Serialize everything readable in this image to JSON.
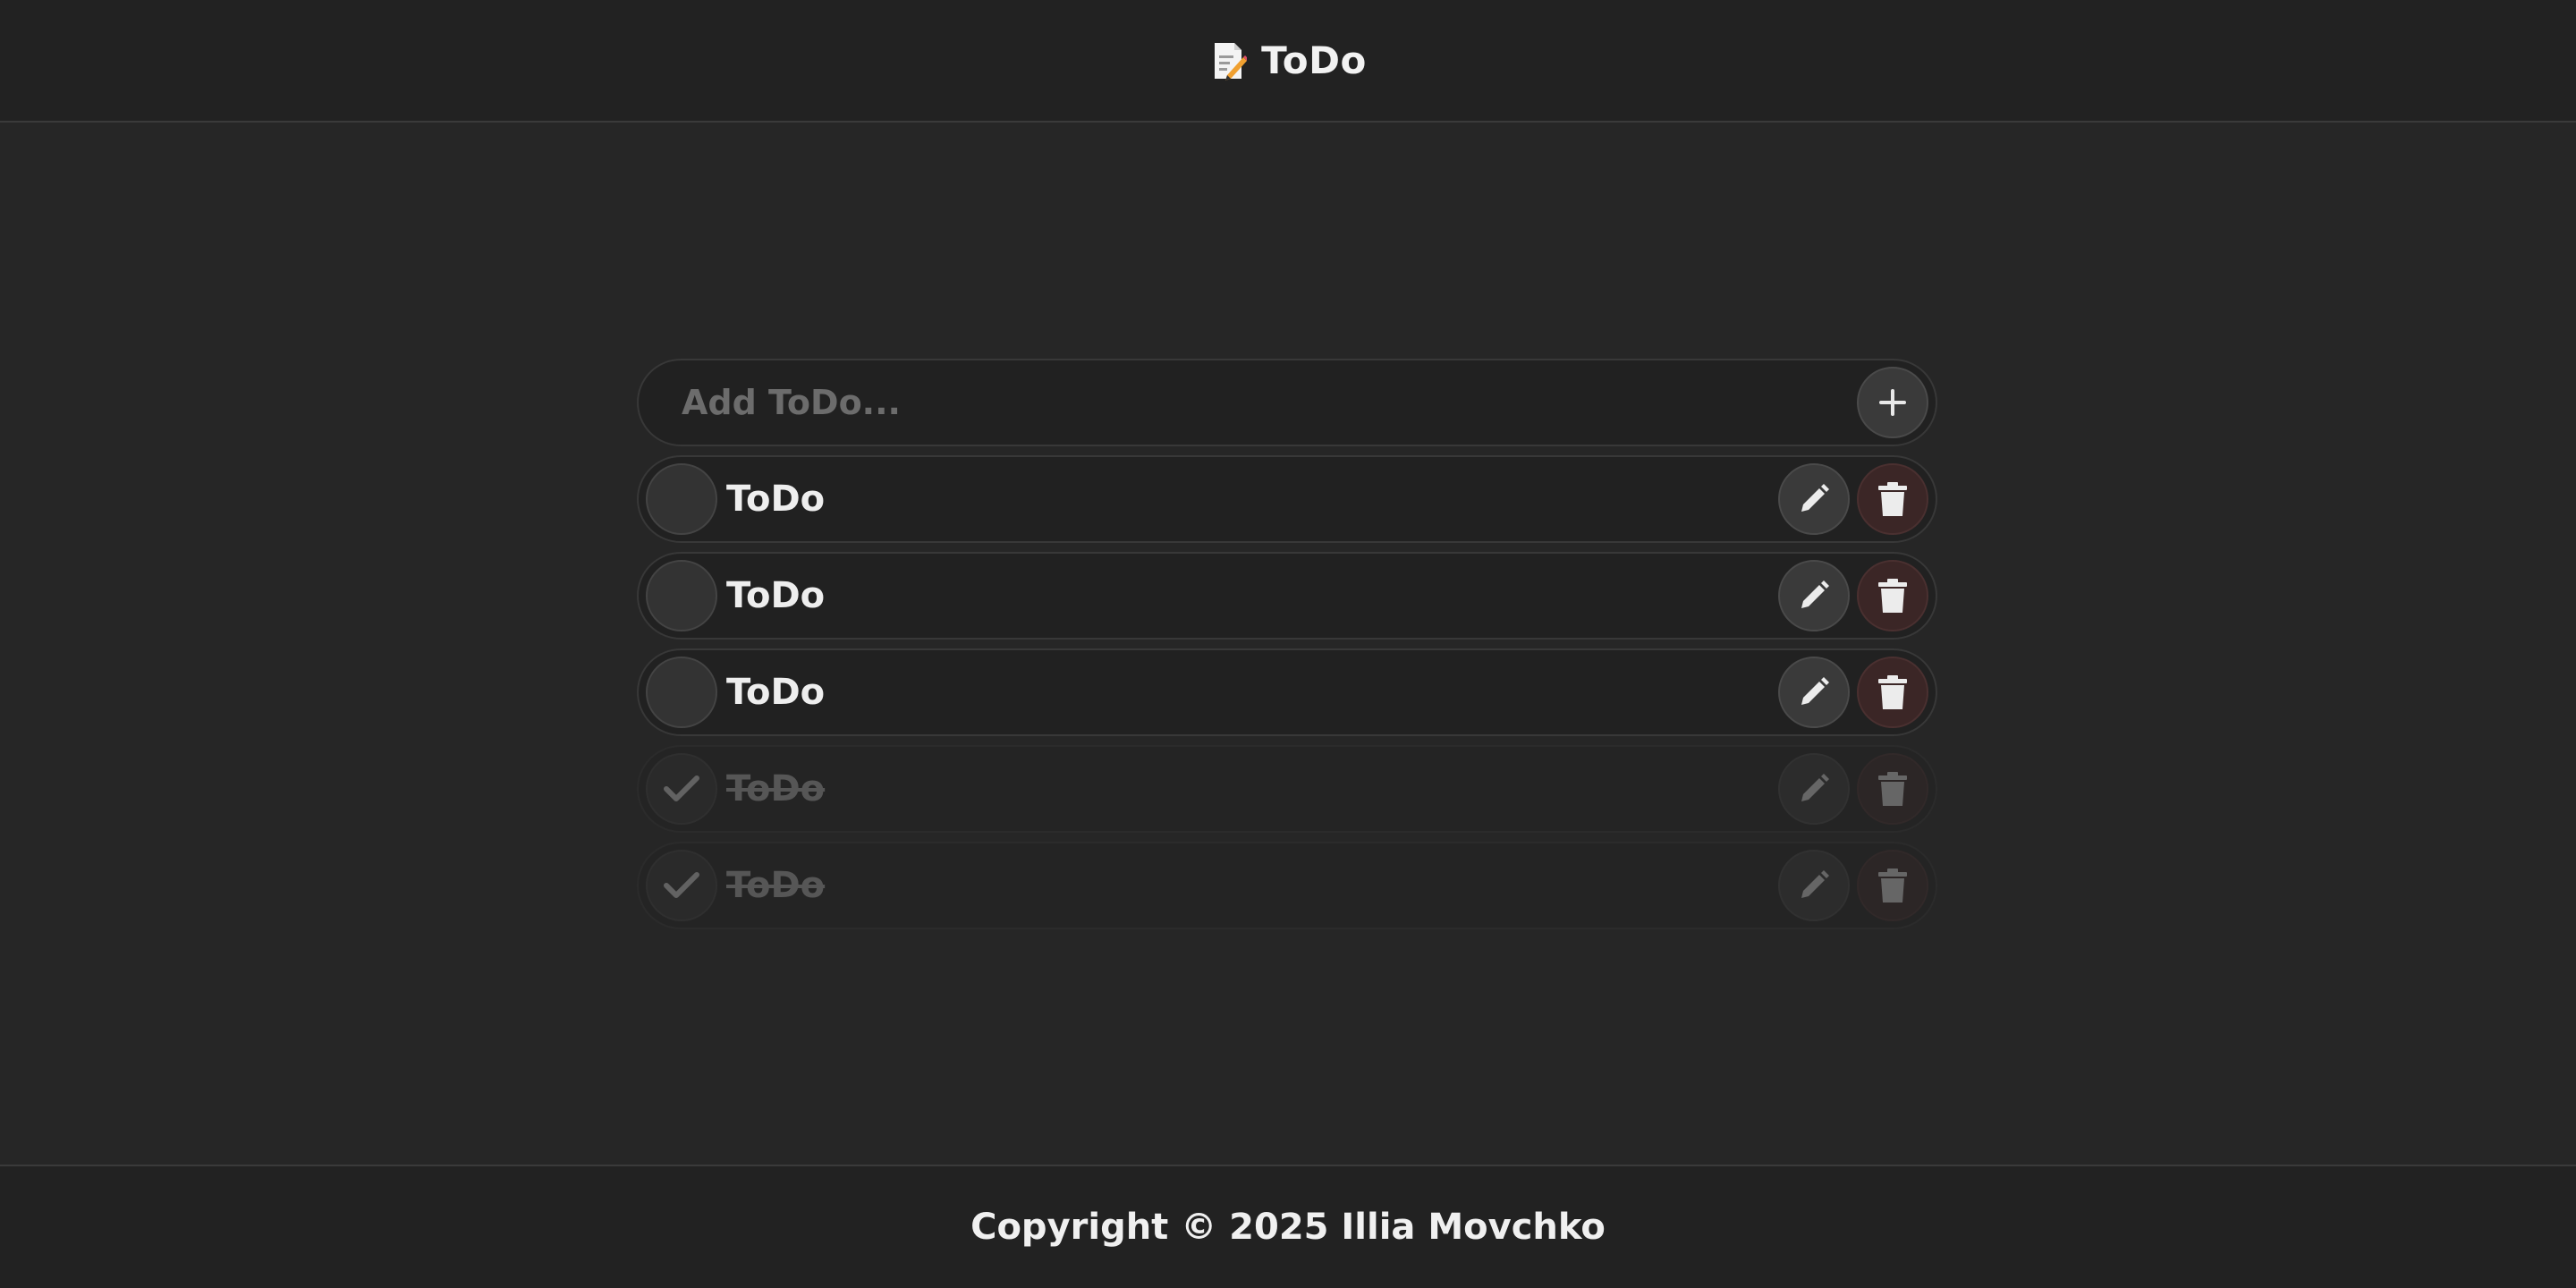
{
  "header": {
    "title": "ToDo",
    "icon": "memo-icon"
  },
  "add": {
    "placeholder": "Add ToDo...",
    "value": "",
    "button_icon": "plus-icon"
  },
  "todos": [
    {
      "text": "ToDo",
      "done": false
    },
    {
      "text": "ToDo",
      "done": false
    },
    {
      "text": "ToDo",
      "done": false
    },
    {
      "text": "ToDo",
      "done": true
    },
    {
      "text": "ToDo",
      "done": true
    }
  ],
  "icons": {
    "edit": "pencil-icon",
    "delete": "trash-icon",
    "check": "checkmark-icon"
  },
  "colors": {
    "background": "#262626",
    "bar": "#222222",
    "row": "#212121",
    "delete_tint": "#3b2626"
  },
  "footer": {
    "copyright": "Copyright © 2025 Illia Movchko"
  }
}
